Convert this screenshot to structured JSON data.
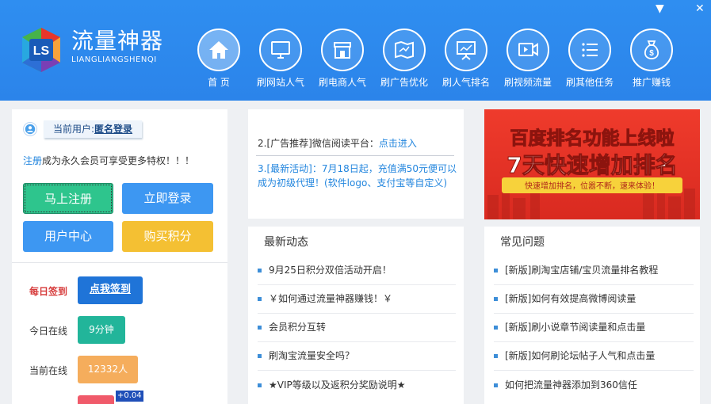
{
  "app": {
    "brand_cn": "流量神器",
    "brand_en": "LIANGLIANGSHENQI",
    "logo_letters": "LS",
    "window_controls": [
      "minimize-icon",
      "close-icon"
    ],
    "minimize_glyph": "▼",
    "close_glyph": "✕"
  },
  "nav": [
    {
      "label": "首 页",
      "icon": "home-icon"
    },
    {
      "label": "刷网站人气",
      "icon": "monitor-icon"
    },
    {
      "label": "刷电商人气",
      "icon": "store-icon"
    },
    {
      "label": "刷广告优化",
      "icon": "map-icon"
    },
    {
      "label": "刷人气排名",
      "icon": "presentation-icon"
    },
    {
      "label": "刷视频流量",
      "icon": "video-icon"
    },
    {
      "label": "刷其他任务",
      "icon": "list-icon"
    },
    {
      "label": "推广赚钱",
      "icon": "money-bag-icon"
    }
  ],
  "user": {
    "current_user_label": "当前用户:",
    "current_user_value": "匿名登录",
    "promo_link": "注册",
    "promo_text": "成为永久会员可享受更多特权！！！",
    "buttons": {
      "register": "马上注册",
      "login": "立即登录",
      "center": "用户中心",
      "buy": "购买积分"
    },
    "stats": {
      "signin_label": "每日签到",
      "signin_button": "点我签到",
      "online_today_label": "今日在线",
      "online_today_value": "9分钟",
      "current_online_label": "当前在线",
      "current_online_value": "12332人",
      "increment": "+0.04"
    }
  },
  "ads": {
    "ad1_text": "2.[广告推荐]微信阅读平台：",
    "ad1_link": "点击进入",
    "ad2_text": "3.[最新活动]：7月18日起，充值满50元便可以成为初级代理！(软件logo、支付宝等自定义)"
  },
  "banner": {
    "line1": "百度排名功能上线啦",
    "line2": "7天快速增加排名",
    "ribbon": "快速增加排名，位嚣不断，速来体验！",
    "colors": {
      "bg": "#e8352a",
      "ribbon": "#f7d23b"
    }
  },
  "news": {
    "title": "最新动态",
    "items": [
      "9月25日积分双倍活动开启！",
      "￥如何通过流量神器赚钱！￥",
      "会员积分互转",
      "刷淘宝流量安全吗？",
      "★VIP等级以及返积分奖励说明★"
    ]
  },
  "faq": {
    "title": "常见问题",
    "items": [
      "[新版]刷淘宝店铺/宝贝流量排名教程",
      "[新版]如何有效提高微博阅读量",
      "[新版]刷小说章节阅读量和点击量",
      "[新版]如何刷论坛帖子人气和点击量",
      "如何把流量神器添加到360信任"
    ]
  },
  "colors": {
    "header": "#2f8ef0",
    "green": "#2ec58d",
    "blue": "#3d97f2",
    "yellow": "#f4c033",
    "teal": "#22b59a",
    "orange": "#f5ad5c",
    "red": "#f05a6a",
    "link": "#2386de"
  }
}
